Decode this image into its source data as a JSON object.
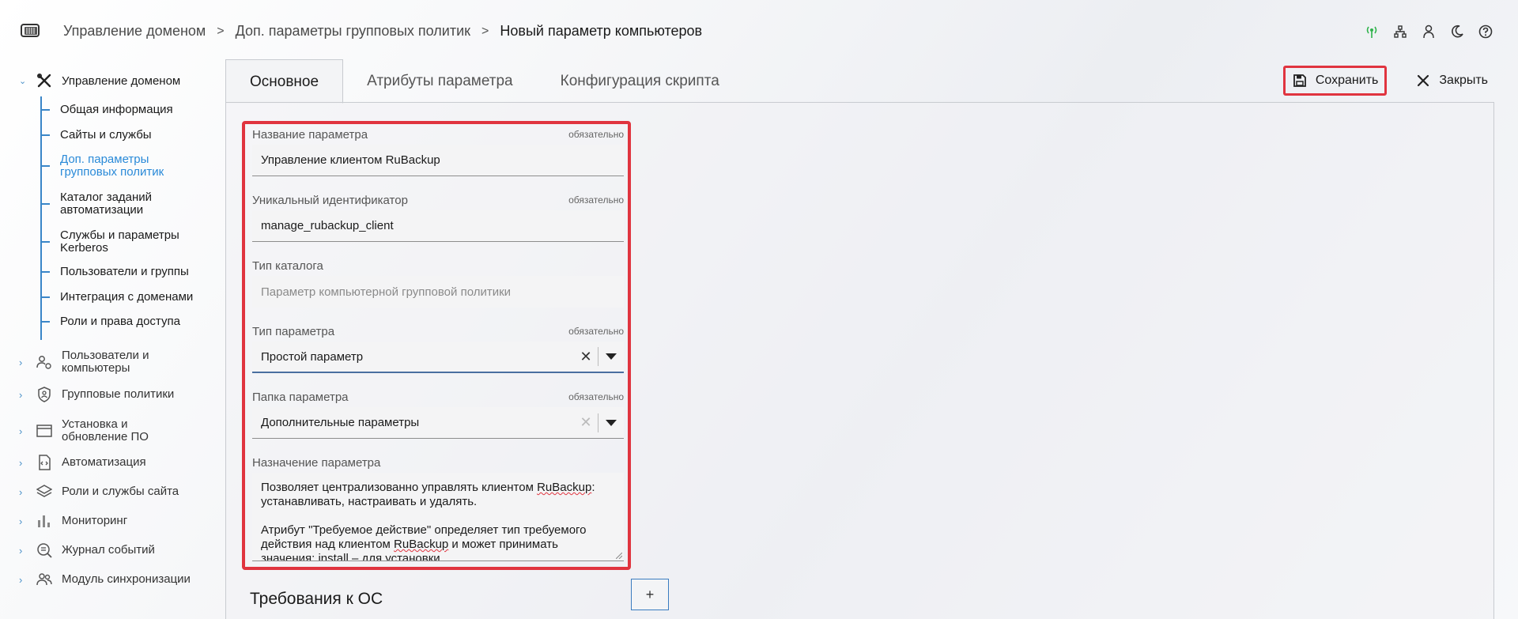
{
  "header": {
    "breadcrumb": [
      "Управление доменом",
      "Доп. параметры групповых политик",
      "Новый параметр компьютеров"
    ],
    "icons": [
      "signal-icon",
      "network-icon",
      "user-icon",
      "moon-icon",
      "help-icon"
    ],
    "signal_color": "#2db34a"
  },
  "sidebar": {
    "root_label": "Управление доменом",
    "subitems": [
      {
        "label": "Общая информация"
      },
      {
        "label": "Сайты и службы"
      },
      {
        "label": "Доп. параметры групповых политик"
      },
      {
        "label": "Каталог заданий автоматизации"
      },
      {
        "label": "Службы и параметры Kerberos"
      },
      {
        "label": "Пользователи и группы"
      },
      {
        "label": "Интеграция с доменами"
      },
      {
        "label": "Роли и права доступа"
      }
    ],
    "items": [
      {
        "label": "Пользователи и компьютеры",
        "icon": "users-computers-icon"
      },
      {
        "label": "Групповые политики",
        "icon": "shield-icon"
      },
      {
        "label": "Установка и обновление ПО",
        "icon": "window-icon"
      },
      {
        "label": "Автоматизация",
        "icon": "code-file-icon"
      },
      {
        "label": "Роли и службы сайта",
        "icon": "layers-icon"
      },
      {
        "label": "Мониторинг",
        "icon": "bar-chart-icon"
      },
      {
        "label": "Журнал событий",
        "icon": "search-list-icon"
      },
      {
        "label": "Модуль синхронизации",
        "icon": "users-sync-icon"
      }
    ]
  },
  "tabs": [
    "Основное",
    "Атрибуты параметра",
    "Конфигурация скрипта"
  ],
  "actions": {
    "save": "Сохранить",
    "close": "Закрыть"
  },
  "form": {
    "required_text": "обязательно",
    "name": {
      "label": "Название параметра",
      "value": "Управление клиентом RuBackup"
    },
    "uid": {
      "label": "Уникальный идентификатор",
      "value": "manage_rubackup_client"
    },
    "catalog": {
      "label": "Тип каталога",
      "placeholder": "Параметр компьютерной групповой политики"
    },
    "ptype": {
      "label": "Тип параметра",
      "value": "Простой параметр"
    },
    "folder": {
      "label": "Папка параметра",
      "value": "Дополнительные параметры"
    },
    "purpose": {
      "label": "Назначение параметра",
      "line1a": "Позволяет централизованно управлять клиентом ",
      "line1b": "RuBackup",
      "line1c": ": устанавливать, настраивать и удалять.",
      "line2a": "Атрибут \"Требуемое действие\" определяет тип требуемого действия над клиентом ",
      "line2b": "RuBackup",
      "line2c": " и может принимать значения: install – для установки"
    }
  },
  "os": {
    "title": "Требования к ОС",
    "add": "+"
  },
  "colors": {
    "accent": "#2a8ad8",
    "highlight": "#e0343f"
  }
}
